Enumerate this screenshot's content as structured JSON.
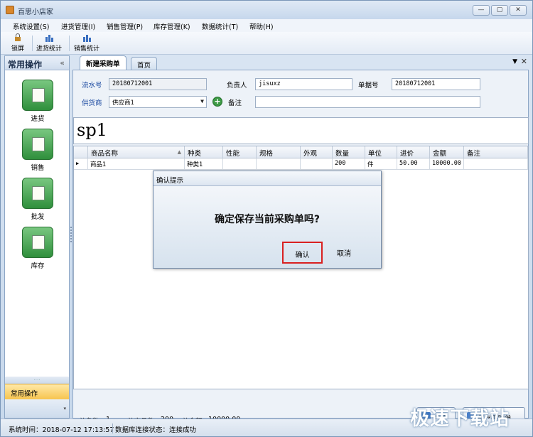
{
  "window": {
    "title": "百思小店家",
    "buttons": [
      "—",
      "▢",
      "✕"
    ]
  },
  "menu": [
    "系统设置(S)",
    "进货管理(I)",
    "销售管理(P)",
    "库存管理(K)",
    "数据统计(T)",
    "帮助(H)"
  ],
  "toolbar": {
    "lock": "锁屏",
    "purchase_stats": "进货统计",
    "sales_stats": "销售统计"
  },
  "sidebar": {
    "title": "常用操作",
    "collapse": "«",
    "items": [
      {
        "label": "进货",
        "icon": "purchase-icon"
      },
      {
        "label": "销售",
        "icon": "sales-icon"
      },
      {
        "label": "批发",
        "icon": "wholesale-icon"
      },
      {
        "label": "库存",
        "icon": "inventory-icon"
      }
    ],
    "bottom_label": "常用操作"
  },
  "tabs": {
    "active": "新建采购单",
    "home": "首页"
  },
  "form": {
    "serial_label": "流水号",
    "serial_value": "20180712001",
    "manager_label": "负责人",
    "manager_value": "jisuxz",
    "bill_label": "单据号",
    "bill_value": "20180712001",
    "supplier_label": "供货商",
    "supplier_value": "供应商1",
    "remark_label": "备注",
    "remark_value": ""
  },
  "barcode_input": "sp1",
  "table": {
    "columns": [
      "商品名称",
      "种类",
      "性能",
      "规格",
      "外观",
      "数量",
      "单位",
      "进价",
      "金额",
      "备注"
    ],
    "rows": [
      [
        "商品1",
        "种类1",
        "",
        "",
        "",
        "200",
        "件",
        "50.00",
        "10000.00",
        ""
      ]
    ],
    "row_marker": "▶"
  },
  "summary": {
    "total_count_label": "总条数",
    "total_count": "1",
    "total_goods_label": "总商品数",
    "total_goods": "200",
    "total_amount_label": "总金额",
    "total_amount": "10000.00"
  },
  "buttons": {
    "reset": "重置",
    "save": "保存采购单"
  },
  "status": {
    "time": "系统时间：2018-07-12 17:13:57",
    "db": "数据库连接状态：连接成功"
  },
  "dialog": {
    "title": "确认提示",
    "message": "确定保存当前采购单吗?",
    "ok": "确认",
    "cancel": "取消"
  },
  "watermark": "极速下载站",
  "colors": {
    "accent_green": "#2f8f3c",
    "highlight_red": "#d92020",
    "label_blue": "#1a48a0"
  }
}
